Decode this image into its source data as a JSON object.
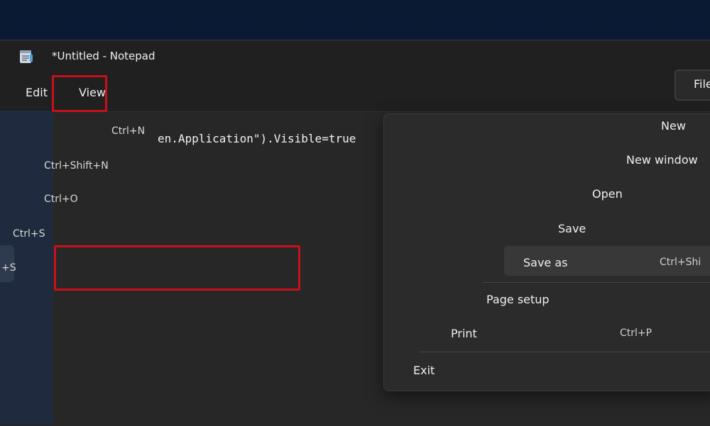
{
  "window": {
    "title": "*Untitled - Notepad"
  },
  "menubar": {
    "file": "File",
    "edit": "Edit",
    "view": "View"
  },
  "editor": {
    "text": "en.Application\").Visible=true"
  },
  "ghost_shortcuts": {
    "new": "Ctrl+N",
    "new_window": "Ctrl+Shift+N",
    "open": "Ctrl+O",
    "save": "Ctrl+S",
    "save_as": "+S"
  },
  "file_menu": {
    "new": "New",
    "new_window": "New window",
    "open": "Open",
    "save": "Save",
    "save_as": "Save as",
    "save_as_shortcut": "Ctrl+Shi",
    "page_setup": "Page setup",
    "print": "Print",
    "print_shortcut": "Ctrl+P",
    "exit": "Exit"
  },
  "colors": {
    "highlight_box": "#c8101a",
    "desktop": "#0b1a33",
    "window_bg": "#202020"
  },
  "icons": {
    "app": "notepad-icon"
  }
}
